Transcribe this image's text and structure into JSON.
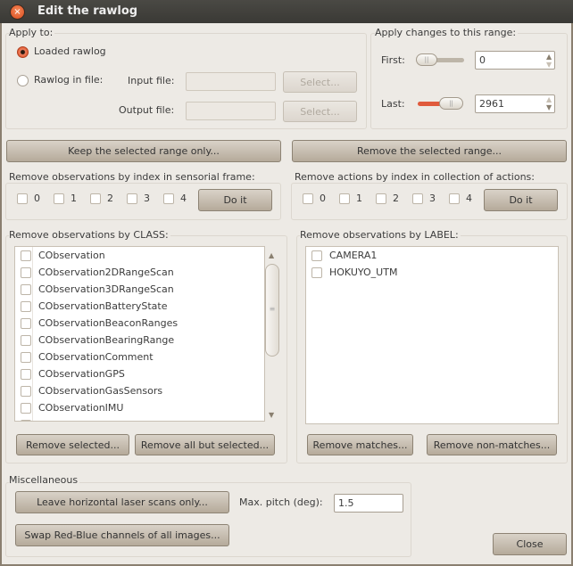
{
  "window": {
    "title": "Edit the rawlog"
  },
  "apply_to": {
    "label": "Apply to:",
    "loaded": "Loaded rawlog",
    "in_file": "Rawlog in file:",
    "input_label": "Input file:",
    "output_label": "Output file:",
    "input_value": "",
    "output_value": "",
    "select1": "Select...",
    "select2": "Select...",
    "selected": "loaded"
  },
  "range": {
    "label": "Apply changes to this range:",
    "first_label": "First:",
    "first_value": "0",
    "last_label": "Last:",
    "last_value": "2961",
    "first_slider_fraction": 0,
    "last_slider_fraction": 1,
    "accent": "#e05a3c"
  },
  "range_buttons": {
    "keep": "Keep the selected range only...",
    "remove": "Remove the selected range..."
  },
  "obs_index": {
    "label": "Remove observations by index in sensorial frame:",
    "items": [
      "0",
      "1",
      "2",
      "3",
      "4"
    ],
    "do_it": "Do it"
  },
  "act_index": {
    "label": "Remove actions by index in collection of actions:",
    "items": [
      "0",
      "1",
      "2",
      "3",
      "4"
    ],
    "do_it": "Do it"
  },
  "by_class": {
    "label": "Remove observations by CLASS:",
    "items": [
      "CObservation",
      "CObservation2DRangeScan",
      "CObservation3DRangeScan",
      "CObservationBatteryState",
      "CObservationBeaconRanges",
      "CObservationBearingRange",
      "CObservationComment",
      "CObservationGPS",
      "CObservationGasSensors",
      "CObservationIMU",
      "CObservationImage"
    ],
    "remove_selected": "Remove selected...",
    "remove_all_but": "Remove all but selected..."
  },
  "by_label": {
    "label": "Remove observations by LABEL:",
    "items": [
      "CAMERA1",
      "HOKUYO_UTM"
    ],
    "remove_matches": "Remove matches...",
    "remove_non_matches": "Remove non-matches..."
  },
  "misc": {
    "label": "Miscellaneous",
    "leave_horizontal": "Leave horizontal laser scans only...",
    "max_pitch_label": "Max. pitch (deg):",
    "max_pitch_value": "1.5",
    "swap": "Swap Red-Blue channels of all images..."
  },
  "close": "Close"
}
